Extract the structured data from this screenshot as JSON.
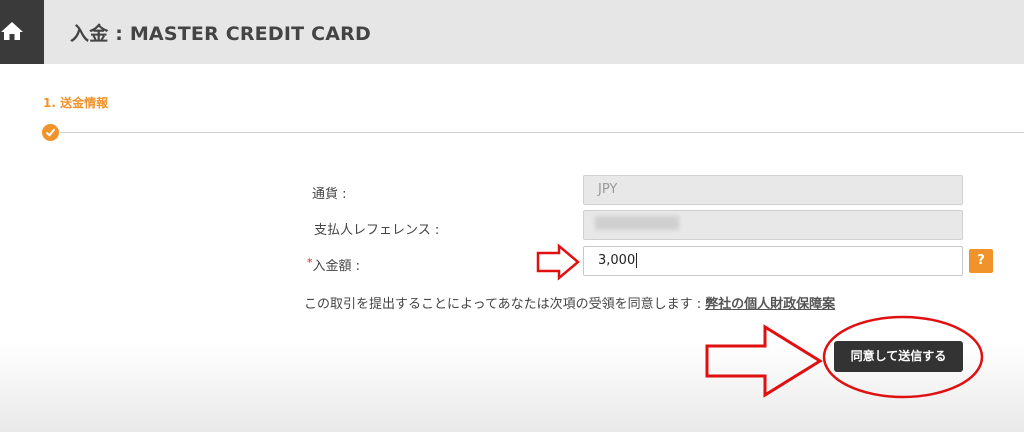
{
  "header": {
    "title": "入金 : MASTER CREDIT CARD",
    "home_icon": "home-icon"
  },
  "step": {
    "label": "1. 送金情報",
    "status_icon": "check-circle-icon"
  },
  "form": {
    "currency_label": "通貨 :",
    "currency_value": "JPY",
    "reference_label": "支払人レフェレンス :",
    "reference_value": "",
    "amount_required_mark": "*",
    "amount_label": "入金額 :",
    "amount_value": "3,000",
    "help_label": "?"
  },
  "consent": {
    "text": "この取引を提出することによってあなたは次項の受領を同意します :",
    "link": "弊社の個人財政保障案"
  },
  "actions": {
    "submit_label": "同意して送信する"
  },
  "colors": {
    "accent": "#f0932b",
    "header_bg": "#e6e6e6",
    "home_bg": "#3a3a3a",
    "button_bg": "#333333",
    "annotation": "#e01010"
  }
}
